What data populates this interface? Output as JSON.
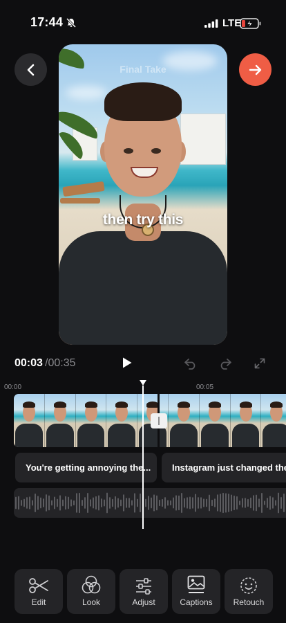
{
  "status_bar": {
    "time": "17:44",
    "network": "LTE"
  },
  "preview": {
    "watermark": "Final Take",
    "caption_overlay": "then try this"
  },
  "playback": {
    "current_time": "00:03",
    "total_time": "/00:35"
  },
  "timeline": {
    "ruler_labels": [
      "00:00",
      "00:05"
    ],
    "captions": [
      "You're getting annoying the...",
      "Instagram just changed the"
    ]
  },
  "toolbar": {
    "items": [
      {
        "label": "Edit",
        "icon": "scissors-icon"
      },
      {
        "label": "Look",
        "icon": "color-circles-icon"
      },
      {
        "label": "Adjust",
        "icon": "sliders-icon"
      },
      {
        "label": "Captions",
        "icon": "captions-image-icon"
      },
      {
        "label": "Retouch",
        "icon": "smiley-icon"
      }
    ]
  },
  "colors": {
    "accent": "#EF5D45",
    "background": "#0E0E10",
    "panel": "#242427"
  }
}
